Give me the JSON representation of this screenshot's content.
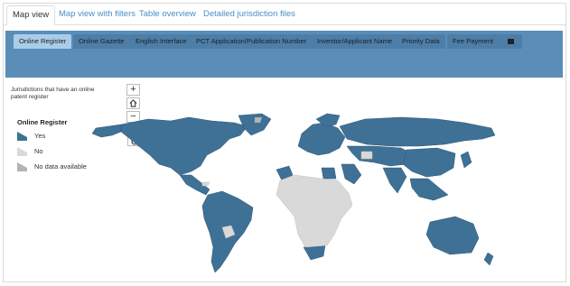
{
  "nav": {
    "tabs": [
      {
        "label": "Map view",
        "active": true
      },
      {
        "label": "Map view with filters",
        "active": false
      },
      {
        "label": "Table overview",
        "active": false
      },
      {
        "label": "Detailed jurisdiction files",
        "active": false
      }
    ]
  },
  "layers": {
    "tabs": [
      {
        "label": "Online Register",
        "active": true
      },
      {
        "label": "Online Gazette",
        "active": false
      },
      {
        "label": "English Interface",
        "active": false
      },
      {
        "label": "PCT Application/Publication Number",
        "active": false
      },
      {
        "label": "Inventor/Applicant Name",
        "active": false
      },
      {
        "label": "Priority Data",
        "active": false
      },
      {
        "label": "Fee Payment",
        "active": false
      }
    ],
    "list_icon": "list-icon"
  },
  "map": {
    "intro_text": "Jurisdictions that have an online patent register",
    "legend_title": "Online Register",
    "legend": [
      {
        "label": "Yes",
        "color": "#3f7196"
      },
      {
        "label": "No",
        "color": "#d9d9d9"
      },
      {
        "label": "No data available",
        "color": "#b3b3b3"
      }
    ],
    "controls": {
      "zoom_in": "+",
      "home": "home-icon",
      "zoom_out": "−",
      "search": "search-icon"
    }
  },
  "colors": {
    "band": "#5a8db8",
    "tab": "#4d7ea8",
    "tab_active": "#a9cde8",
    "yes": "#3f7196",
    "no": "#d9d9d9",
    "link": "#4a8ec7"
  }
}
